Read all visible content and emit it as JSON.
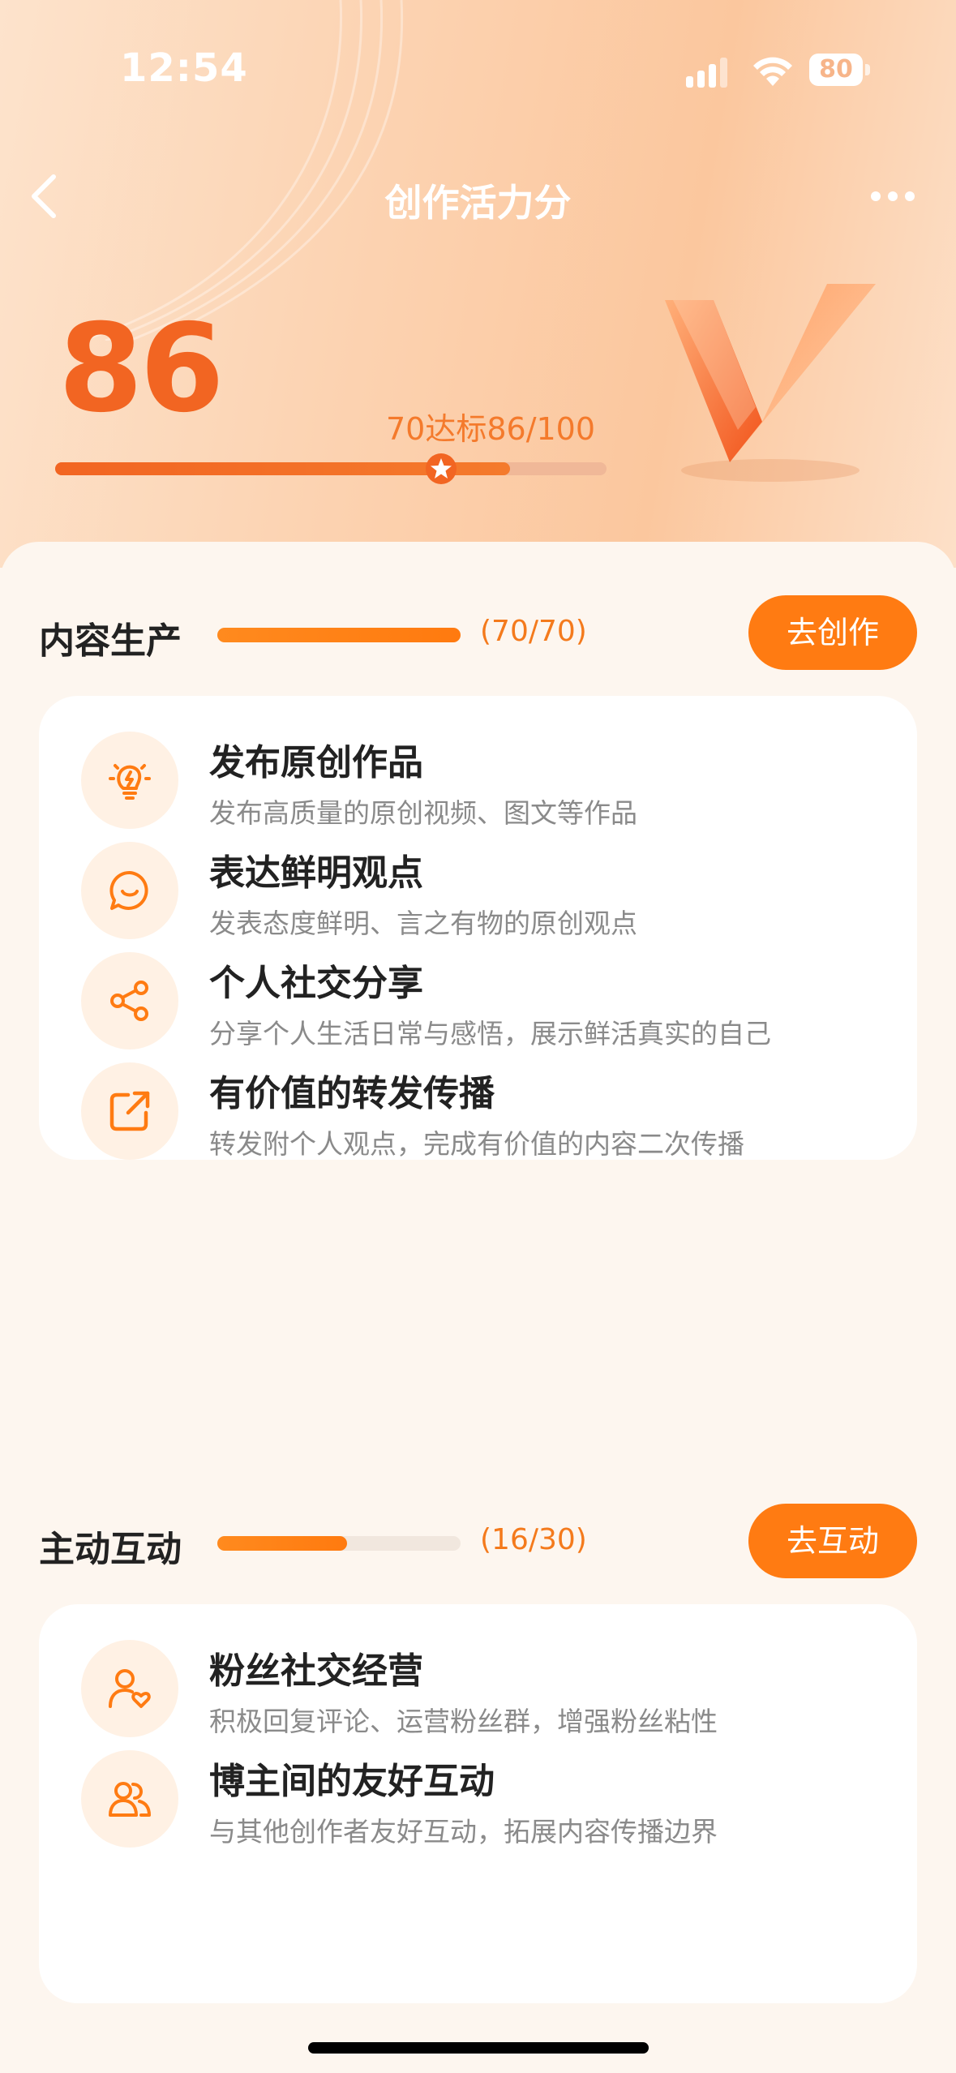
{
  "status_bar": {
    "time": "12:54",
    "battery": "80"
  },
  "nav": {
    "title": "创作活力分"
  },
  "score": {
    "value": "86",
    "target_text": "70达标86/100",
    "progress": 0.86,
    "pass_mark": 0.7
  },
  "sections": [
    {
      "title": "内容生产",
      "count": "(70/70)",
      "progress": 1.0,
      "button": "去创作",
      "items": [
        {
          "title": "发布原创作品",
          "desc": "发布高质量的原创视频、图文等作品",
          "icon": "lightbulb-icon"
        },
        {
          "title": "表达鲜明观点",
          "desc": "发表态度鲜明、言之有物的原创观点",
          "icon": "chat-smile-icon"
        },
        {
          "title": "个人社交分享",
          "desc": "分享个人生活日常与感悟，展示鲜活真实的自己",
          "icon": "share-icon"
        },
        {
          "title": "有价值的转发传播",
          "desc": "转发附个人观点，完成有价值的内容二次传播",
          "icon": "forward-icon"
        }
      ]
    },
    {
      "title": "主动互动",
      "count": "(16/30)",
      "progress": 0.533,
      "button": "去互动",
      "items": [
        {
          "title": "粉丝社交经营",
          "desc": "积极回复评论、运营粉丝群，增强粉丝粘性",
          "icon": "user-heart-icon"
        },
        {
          "title": "博主间的友好互动",
          "desc": "与其他创作者友好互动，拓展内容传播边界",
          "icon": "users-icon"
        }
      ]
    }
  ],
  "colors": {
    "accent": "#ff7b12",
    "score": "#f26522",
    "icon_bg": "#fff1e4"
  }
}
